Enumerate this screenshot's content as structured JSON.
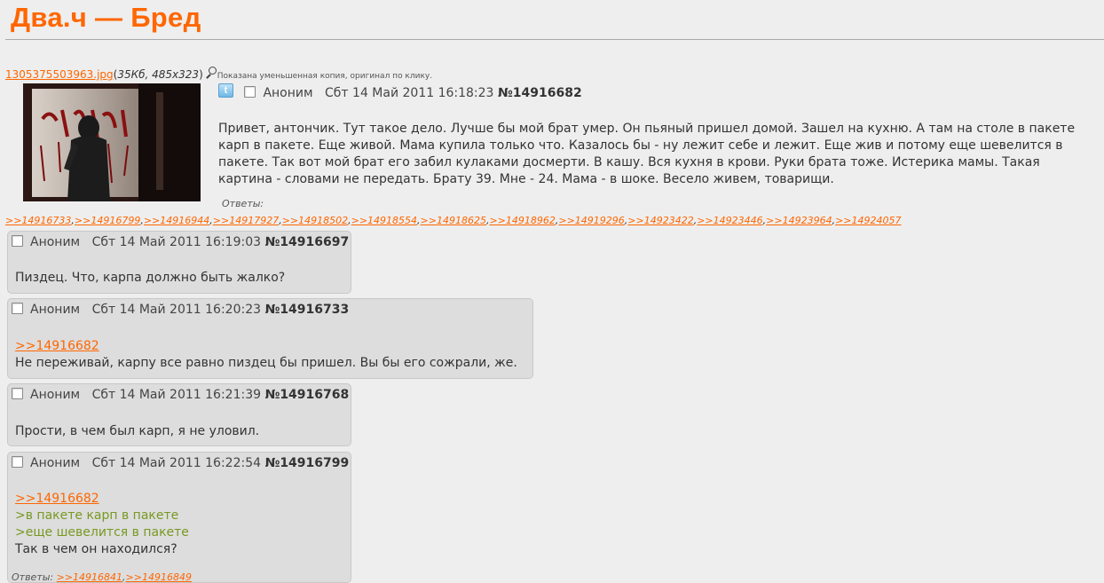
{
  "site": {
    "title": "Два.ч — Бред"
  },
  "op": {
    "file": {
      "name": "1305375503963.jpg",
      "meta": "35Кб, 485x323",
      "hint": "Показана уменьшенная копия, оригинал по клику."
    },
    "twitter_glyph": "t",
    "name": "Аноним",
    "date": "Сбт 14 Май 2011 16:18:23",
    "num": "№14916682",
    "text": "Привет, антончик. Тут такое дело. Лучше бы мой брат умер. Он пьяный пришел домой. Зашел на кухню. А там на столе в пакете карп в пакете. Еще живой. Мама купила только что. Казалось бы - ну лежит себе и лежит. Еще жив и потому еще шевелится в пакете. Так вот мой брат его забил кулаками досмерти. В кашу. Вся кухня в крови. Руки брата тоже. Истерика мамы. Такая картина - словами не передать. Брату 39. Мне - 24. Мама - в шоке. Весело живем, товарищи.",
    "replies_label": "Ответы:",
    "replies": [
      ">>14916733",
      ">>14916799",
      ">>14916944",
      ">>14917927",
      ">>14918502",
      ">>14918554",
      ">>14918625",
      ">>14918962",
      ">>14919296",
      ">>14923422",
      ">>14923446",
      ">>14923964",
      ">>14924057"
    ]
  },
  "replies": [
    {
      "name": "Аноним",
      "date": "Сбт 14 Май 2011 16:19:03",
      "num": "№14916697",
      "lines": [
        {
          "t": "text",
          "v": "Пиздец. Что, карпа должно быть жалко?"
        }
      ]
    },
    {
      "name": "Аноним",
      "date": "Сбт 14 Май 2011 16:20:23",
      "num": "№14916733",
      "lines": [
        {
          "t": "ref",
          "v": ">>14916682"
        },
        {
          "t": "text",
          "v": "Не переживай, карпу все равно пиздец бы пришел. Вы бы его сожрали, же."
        }
      ]
    },
    {
      "name": "Аноним",
      "date": "Сбт 14 Май 2011 16:21:39",
      "num": "№14916768",
      "lines": [
        {
          "t": "text",
          "v": "Прости, в чем был карп, я не уловил."
        }
      ]
    },
    {
      "name": "Аноним",
      "date": "Сбт 14 Май 2011 16:22:54",
      "num": "№14916799",
      "lines": [
        {
          "t": "ref",
          "v": ">>14916682"
        },
        {
          "t": "quote",
          "v": ">в пакете карп в пакете"
        },
        {
          "t": "quote",
          "v": ">еще шевелится в пакете"
        },
        {
          "t": "text",
          "v": "Так в чем он находился?"
        }
      ],
      "replies_label": "Ответы:",
      "replies": [
        ">>14916841",
        ">>14916849"
      ]
    }
  ]
}
